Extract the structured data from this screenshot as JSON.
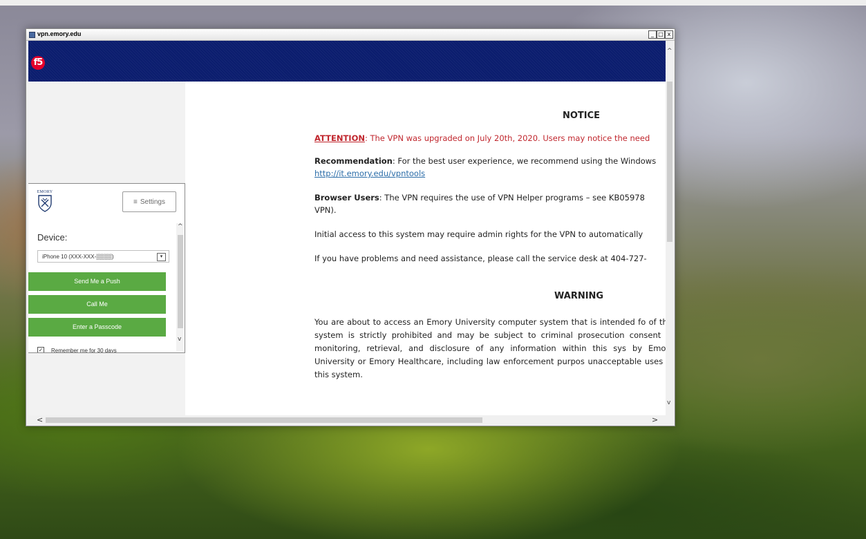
{
  "window": {
    "title": "vpn.emory.edu",
    "minimize": "_",
    "maximize": "□",
    "close": "x"
  },
  "banner": {
    "logo": "f5",
    "color": "#0b1d6e"
  },
  "duo": {
    "brand": "EMORY",
    "settings_label": "Settings",
    "settings_icon": "≡",
    "device_label": "Device:",
    "device_value": "iPhone 10 (XXX-XXX-▒▒▒▒)",
    "select_arrow": "▾",
    "buttons": [
      "Send Me a Push",
      "Call Me",
      "Enter a Passcode"
    ],
    "remember_label": "Remember me for 30 days",
    "remember_checked": "✓",
    "accent": "#5aaa43"
  },
  "content": {
    "notice_title": "NOTICE",
    "attention_label": "ATTENTION",
    "attention_text": ": The VPN was upgraded on July 20th, 2020. Users may notice the need",
    "recommendation_label": "Recommendation",
    "recommendation_text": ": For the best user experience, we recommend using the Windows",
    "recommendation_link": "http://it.emory.edu/vpntools",
    "browser_label": "Browser Users",
    "browser_text": ":  The VPN requires the use of VPN Helper programs – see KB05978",
    "browser_text2": "VPN).",
    "initial_access": "Initial access to this system may require admin rights for the VPN to automatically",
    "problems": "If you have problems and need assistance, please call the service desk at 404-727-",
    "warning_title": "WARNING",
    "warning_text": "You are about to access an Emory University computer system that is intended fo of this system is strictly prohibited and may be subject to criminal prosecution consent to monitoring, retrieval, and disclosure of any information within this sys by Emory University or Emory Healthcare, including law enforcement purpos unacceptable uses of this system."
  },
  "scrollbars": {
    "up": "^",
    "down": "v",
    "left": "<",
    "right": ">"
  }
}
